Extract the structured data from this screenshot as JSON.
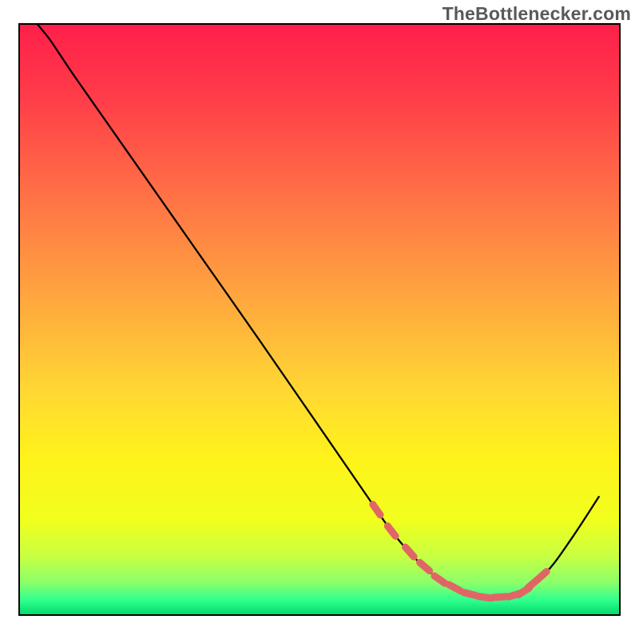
{
  "watermark": "TheBottlenecker.com",
  "chart_data": {
    "type": "line",
    "title": "",
    "xlabel": "",
    "ylabel": "",
    "xlim": [
      0,
      100
    ],
    "ylim": [
      0,
      100
    ],
    "grid": false,
    "legend": false,
    "background_gradient": {
      "stops": [
        {
          "offset": 0.0,
          "color": "#ff1f4a"
        },
        {
          "offset": 0.12,
          "color": "#ff3b49"
        },
        {
          "offset": 0.28,
          "color": "#ff6e46"
        },
        {
          "offset": 0.45,
          "color": "#ffa23f"
        },
        {
          "offset": 0.62,
          "color": "#ffd733"
        },
        {
          "offset": 0.73,
          "color": "#fff21b"
        },
        {
          "offset": 0.84,
          "color": "#f1ff1d"
        },
        {
          "offset": 0.9,
          "color": "#c8ff41"
        },
        {
          "offset": 0.945,
          "color": "#8cff6a"
        },
        {
          "offset": 0.975,
          "color": "#2fff8e"
        },
        {
          "offset": 1.0,
          "color": "#00d96a"
        }
      ]
    },
    "series": [
      {
        "name": "bottleneck-curve",
        "color": "#000000",
        "width": 2.3,
        "x": [
          3.0,
          5.0,
          7.0,
          10.0,
          20.0,
          30.0,
          40.0,
          50.0,
          58.0,
          62.0,
          66.0,
          70.0,
          74.0,
          78.0,
          82.0,
          84.0,
          88.0,
          92.0,
          96.5
        ],
        "y": [
          100.0,
          97.5,
          94.5,
          90.0,
          75.5,
          61.0,
          46.5,
          31.8,
          20.0,
          14.2,
          9.5,
          6.0,
          3.8,
          2.9,
          3.2,
          4.0,
          7.5,
          13.0,
          20.0
        ]
      }
    ],
    "marker_band": {
      "name": "optimal-range-band",
      "color": "#e06666",
      "xs": [
        59.5,
        62.0,
        65.0,
        67.5,
        70.0,
        72.5,
        75.0,
        77.5,
        80.0,
        82.5,
        84.0,
        85.5,
        87.0
      ]
    }
  }
}
